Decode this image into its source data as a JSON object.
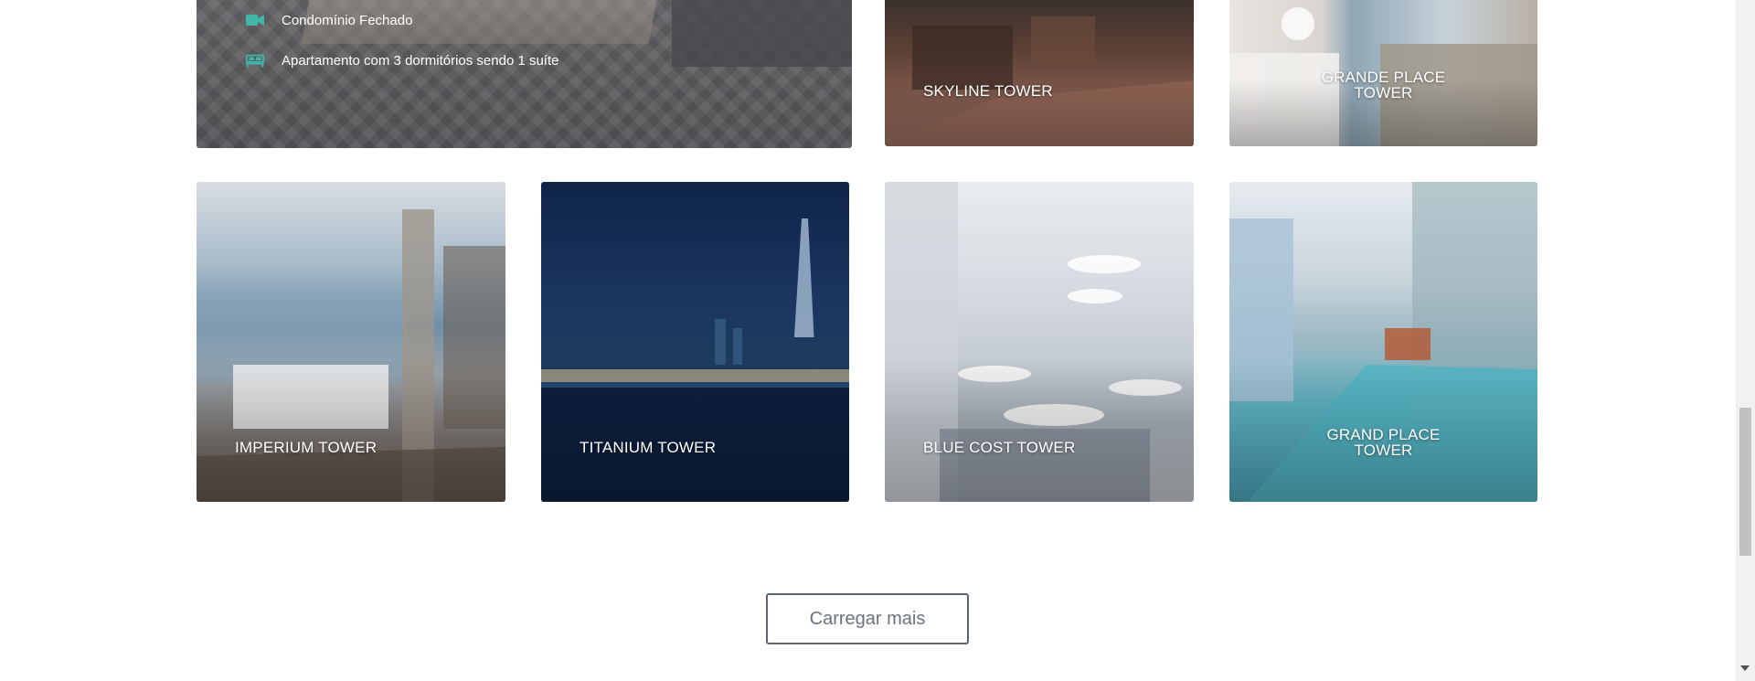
{
  "featured": {
    "features": [
      {
        "icon": "video-camera-icon",
        "label": "Condomínio Fechado"
      },
      {
        "icon": "bed-icon",
        "label": "Apartamento com 3 dormitórios sendo 1 suíte"
      }
    ]
  },
  "properties": [
    {
      "name": "SKYLINE TOWER"
    },
    {
      "name": "GRANDE PLACE TOWER"
    },
    {
      "name": "IMPERIUM TOWER"
    },
    {
      "name": "TITANIUM TOWER"
    },
    {
      "name": "BLUE COST TOWER"
    },
    {
      "name": "GRAND PLACE TOWER"
    }
  ],
  "load_more": {
    "label": "Carregar mais"
  },
  "colors": {
    "feature_icon": "#3fb6a8",
    "button_border": "#5b6670"
  }
}
